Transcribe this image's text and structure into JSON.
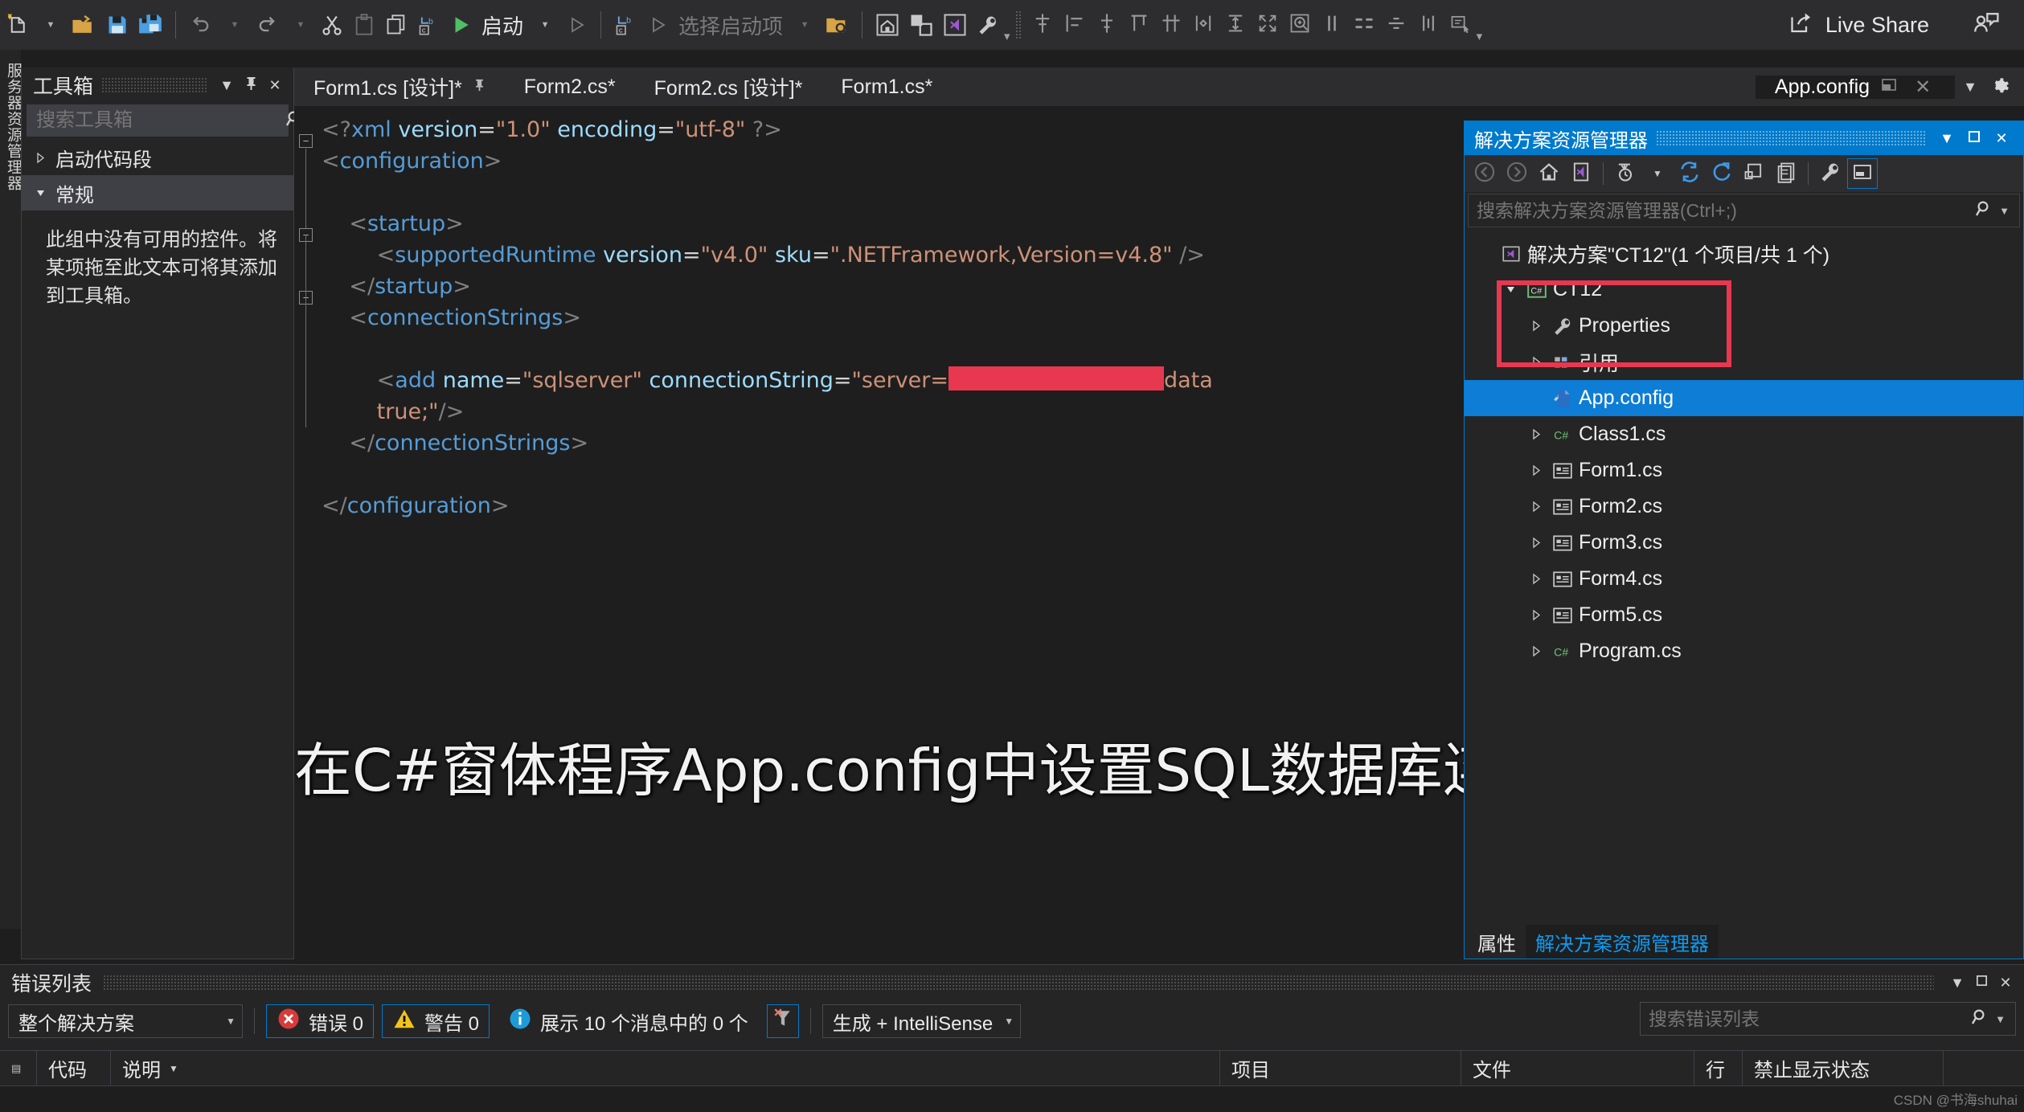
{
  "toolbar": {
    "run_label": "启动",
    "startup_placeholder": "选择启动项",
    "live_share_label": "Live Share",
    "icons": [
      "new-file-icon",
      "open-folder-icon",
      "save-icon",
      "save-all-icon",
      "undo-icon",
      "redo-icon",
      "cut-icon",
      "paste-icon",
      "copy-icon",
      "navigate-backward-icon",
      "run-icon",
      "home-icon",
      "window-layout-icon",
      "vs-window-icon",
      "wrench-icon",
      "align-tops-icon",
      "align-lefts-icon",
      "align-middles-icon",
      "align-top-edges-icon",
      "make-same-width-icon",
      "center-horizontally-icon",
      "make-same-height-icon",
      "size-to-fit-icon",
      "zoom-icon",
      "spacing-equal-icon",
      "align-to-grid-icon",
      "center-vertically-icon",
      "increase-spacing-icon",
      "tab-order-icon"
    ]
  },
  "edge_tab": {
    "label": "服务器资源管理器"
  },
  "toolbox": {
    "title": "工具箱",
    "search_placeholder": "搜索工具箱",
    "nodes": [
      {
        "label": "启动代码段",
        "expanded": false,
        "selected": false
      },
      {
        "label": "常规",
        "expanded": true,
        "selected": true
      }
    ],
    "empty_message": "此组中没有可用的控件。将某项拖至此文本可将其添加到工具箱。"
  },
  "editor_tabs": {
    "tabs": [
      {
        "label": "Form1.cs [设计]*",
        "active": false,
        "pinned": true
      },
      {
        "label": "Form2.cs*",
        "active": false,
        "pinned": false
      },
      {
        "label": "Form2.cs [设计]*",
        "active": false,
        "pinned": false
      },
      {
        "label": "Form1.cs*",
        "active": false,
        "pinned": false
      },
      {
        "label": "App.config",
        "active": true,
        "pinned": false
      }
    ],
    "close_label": "✕"
  },
  "code": {
    "lines": [
      {
        "id": "l1",
        "segments": [
          {
            "t": "<?",
            "c": "punc"
          },
          {
            "t": "xml",
            "c": "tag"
          },
          {
            "t": " ",
            "c": "plain"
          },
          {
            "t": "version",
            "c": "attr"
          },
          {
            "t": "=",
            "c": "eq"
          },
          {
            "t": "\"1.0\"",
            "c": "val"
          },
          {
            "t": " ",
            "c": "plain"
          },
          {
            "t": "encoding",
            "c": "attr"
          },
          {
            "t": "=",
            "c": "eq"
          },
          {
            "t": "\"utf-8\"",
            "c": "val"
          },
          {
            "t": " ?>",
            "c": "punc"
          }
        ],
        "indent": 0
      },
      {
        "id": "l2",
        "segments": [
          {
            "t": "<",
            "c": "punc"
          },
          {
            "t": "configuration",
            "c": "tag"
          },
          {
            "t": ">",
            "c": "punc"
          }
        ],
        "indent": 0
      },
      {
        "id": "l3",
        "segments": [],
        "indent": 0
      },
      {
        "id": "l4",
        "segments": [
          {
            "t": "<",
            "c": "punc"
          },
          {
            "t": "startup",
            "c": "tag"
          },
          {
            "t": ">",
            "c": "punc"
          }
        ],
        "indent": 1
      },
      {
        "id": "l5",
        "segments": [
          {
            "t": "<",
            "c": "punc"
          },
          {
            "t": "supportedRuntime",
            "c": "tag"
          },
          {
            "t": " ",
            "c": "plain"
          },
          {
            "t": "version",
            "c": "attr"
          },
          {
            "t": "=",
            "c": "eq"
          },
          {
            "t": "\"v4.0\"",
            "c": "val"
          },
          {
            "t": " ",
            "c": "plain"
          },
          {
            "t": "sku",
            "c": "attr"
          },
          {
            "t": "=",
            "c": "eq"
          },
          {
            "t": "\".NETFramework,Version=v4.8\"",
            "c": "val"
          },
          {
            "t": " />",
            "c": "punc"
          }
        ],
        "indent": 2
      },
      {
        "id": "l6",
        "segments": [
          {
            "t": "</",
            "c": "punc"
          },
          {
            "t": "startup",
            "c": "tag"
          },
          {
            "t": ">",
            "c": "punc"
          }
        ],
        "indent": 1
      },
      {
        "id": "l7",
        "segments": [
          {
            "t": "<",
            "c": "punc"
          },
          {
            "t": "connectionStrings",
            "c": "tag"
          },
          {
            "t": ">",
            "c": "punc"
          }
        ],
        "indent": 1
      },
      {
        "id": "l8",
        "segments": [],
        "indent": 0
      },
      {
        "id": "l9",
        "segments": [
          {
            "t": "<",
            "c": "punc"
          },
          {
            "t": "add",
            "c": "tag"
          },
          {
            "t": " ",
            "c": "plain"
          },
          {
            "t": "name",
            "c": "attr"
          },
          {
            "t": "=",
            "c": "eq"
          },
          {
            "t": "\"sqlserver\"",
            "c": "val"
          },
          {
            "t": " ",
            "c": "plain"
          },
          {
            "t": "connectionString",
            "c": "attr"
          },
          {
            "t": "=",
            "c": "eq"
          },
          {
            "t": "\"server=",
            "c": "val"
          },
          {
            "t": "",
            "c": "redact"
          },
          {
            "t": "data",
            "c": "val"
          }
        ],
        "indent": 2
      },
      {
        "id": "l10",
        "segments": [
          {
            "t": "true;\"",
            "c": "val"
          },
          {
            "t": "/>",
            "c": "punc"
          }
        ],
        "indent": 2
      },
      {
        "id": "l11",
        "segments": [
          {
            "t": "</",
            "c": "punc"
          },
          {
            "t": "connectionStrings",
            "c": "tag"
          },
          {
            "t": ">",
            "c": "punc"
          }
        ],
        "indent": 1
      },
      {
        "id": "l12",
        "segments": [],
        "indent": 0
      },
      {
        "id": "l13",
        "segments": [
          {
            "t": "</",
            "c": "punc"
          },
          {
            "t": "configuration",
            "c": "tag"
          },
          {
            "t": ">",
            "c": "punc"
          }
        ],
        "indent": 0
      }
    ],
    "redaction_color": "#e8384f"
  },
  "watermark": {
    "text": "在C#窗体程序App.config中设置SQL数据库连接"
  },
  "solution_explorer": {
    "title": "解决方案资源管理器",
    "search_placeholder": "搜索解决方案资源管理器(Ctrl+;)",
    "toolbar_icons": [
      "back-icon",
      "forward-icon",
      "home-icon",
      "vs-solution-icon",
      "pending-changes-icon",
      "sync-icon",
      "refresh-icon",
      "collapse-all-icon",
      "show-all-files-icon",
      "properties-wrench-icon",
      "preview-selected-items-icon"
    ],
    "tree": [
      {
        "label": "解决方案\"CT12\"(1 个项目/共 1 个)",
        "depth": 0,
        "icon": "solution-icon",
        "twisty": "none",
        "selected": false
      },
      {
        "label": "CT12",
        "depth": 1,
        "icon": "csharp-project-icon",
        "twisty": "down",
        "selected": false
      },
      {
        "label": "Properties",
        "depth": 2,
        "icon": "wrench-icon",
        "twisty": "right",
        "selected": false
      },
      {
        "label": "引用",
        "depth": 2,
        "icon": "references-icon",
        "twisty": "right",
        "selected": false
      },
      {
        "label": "App.config",
        "depth": 2,
        "icon": "config-icon",
        "twisty": "none",
        "selected": true
      },
      {
        "label": "Class1.cs",
        "depth": 2,
        "icon": "csharp-file-icon",
        "twisty": "right",
        "selected": false
      },
      {
        "label": "Form1.cs",
        "depth": 2,
        "icon": "form-icon",
        "twisty": "right",
        "selected": false
      },
      {
        "label": "Form2.cs",
        "depth": 2,
        "icon": "form-icon",
        "twisty": "right",
        "selected": false
      },
      {
        "label": "Form3.cs",
        "depth": 2,
        "icon": "form-icon",
        "twisty": "right",
        "selected": false
      },
      {
        "label": "Form4.cs",
        "depth": 2,
        "icon": "form-icon",
        "twisty": "right",
        "selected": false
      },
      {
        "label": "Form5.cs",
        "depth": 2,
        "icon": "form-icon",
        "twisty": "right",
        "selected": false
      },
      {
        "label": "Program.cs",
        "depth": 2,
        "icon": "csharp-file-icon",
        "twisty": "right",
        "selected": false
      }
    ],
    "bottom_tabs": [
      {
        "label": "属性",
        "active": false
      },
      {
        "label": "解决方案资源管理器",
        "active": true
      }
    ],
    "accent_color": "#007acc",
    "selection_color": "#0d7dd6",
    "highlight_box_color": "#e8384f"
  },
  "error_list": {
    "title": "错误列表",
    "scope_value": "整个解决方案",
    "errors_label": "错误 0",
    "warnings_label": "警告 0",
    "messages_label": "展示 10 个消息中的 0 个",
    "build_filter_label": "生成 + IntelliSense",
    "search_placeholder": "搜索错误列表",
    "columns": [
      "",
      "代码",
      "说明",
      "项目",
      "文件",
      "行",
      "禁止显示状态"
    ]
  },
  "watermark_credit": {
    "text": "CSDN @书海shuhai"
  }
}
